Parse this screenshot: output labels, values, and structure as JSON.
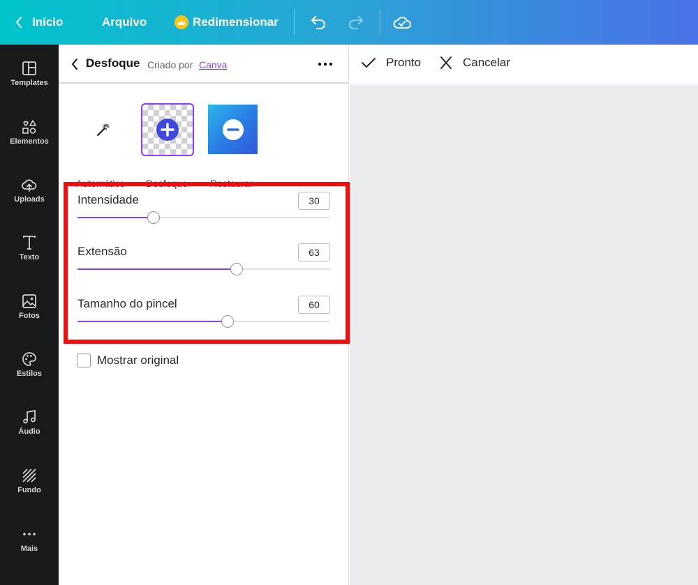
{
  "topbar": {
    "home_label": "Início",
    "file_label": "Arquivo",
    "resize_label": "Redimensionar",
    "gradient_start": "#00c4cc",
    "gradient_end": "#4a72e6"
  },
  "rail": {
    "items": [
      {
        "label": "Templates",
        "icon": "templates-icon"
      },
      {
        "label": "Elementos",
        "icon": "elements-icon"
      },
      {
        "label": "Uploads",
        "icon": "upload-cloud-icon"
      },
      {
        "label": "Texto",
        "icon": "text-icon"
      },
      {
        "label": "Fotos",
        "icon": "photo-icon"
      },
      {
        "label": "Estilos",
        "icon": "palette-icon"
      },
      {
        "label": "Áudio",
        "icon": "music-note-icon"
      },
      {
        "label": "Fundo",
        "icon": "background-stripes-icon"
      },
      {
        "label": "Mais",
        "icon": "more-dots-icon"
      }
    ]
  },
  "panel": {
    "title": "Desfoque",
    "created_by": "Criado por",
    "creator_link": "Canva",
    "tools": {
      "auto_label": "Automático",
      "blur_label": "Desfoque",
      "restore_label": "Restaurar"
    },
    "sliders": [
      {
        "label": "Intensidade",
        "value": "30",
        "fraction": 0.3
      },
      {
        "label": "Extensão",
        "value": "63",
        "fraction": 0.63
      },
      {
        "label": "Tamanho do pincel",
        "value": "60",
        "fraction": 0.595
      }
    ],
    "show_original_label": "Mostrar original",
    "accent_color": "#8b3dff",
    "highlight_color": "#f40b0b"
  },
  "canvas": {
    "done_label": "Pronto",
    "cancel_label": "Cancelar"
  }
}
